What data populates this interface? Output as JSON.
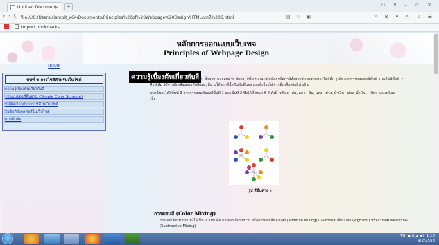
{
  "browser": {
    "tab_title": "Untitled Document",
    "url": "file:///C:/Users/siambit_x64/Documents/Principles%20of%20Webpage%20Design/HTML/บทที่%206.html",
    "bookmarks_label": "Import bookmarks"
  },
  "page": {
    "title_th": "หลักการออกแบบเว็บเพจ",
    "title_en": "Principles of Webpage Design"
  },
  "sidebar": {
    "home_label": "HOME",
    "menu_title": "บทที่ 6 การใช้สีสำหรับเว็บไซต์",
    "items": [
      {
        "label": "ความรู้เบื้องต้นเกี่ยวกับสี"
      },
      {
        "label": "รูปแบบของสีพื้นฐาน (Simple Color Scheme)"
      },
      {
        "label": "ข้อคิดเกี่ยวกับการใช้สีในเว็บไซต์"
      },
      {
        "label": "ปัจจัยที่ส่งผลต่อสีในเว็บไซต์"
      },
      {
        "label": "แบบฝึกหัด"
      }
    ]
  },
  "content": {
    "heading": "ความรู้เบื้องต้นเกี่ยวกับสี",
    "para1": "แม่สีหรือสีขั้นต้น (Primary Color) ทั้งสามประกอบด้วย สีแดง, สีน้ำเงินและสีเหลือง เมื่อนำสีทั้งสามสีมาผสมกันจะได้สีอื่น ๆ อีก จากการผสมแม่สีขั้นที่ 1 จะได้สีขั้นที่ 2 คือ สีส้ม ได้จากสีเหลืองผสมกับสีแดง, สีม่วงได้จากสีน้ำเงินกับสีแดง และสีเขียวได้จากสีเหลืองกับสีน้ำเงิน",
    "para2": "จากนั้นจะได้สีขั้นที่ 3 จากการผสมสีของสีขั้นที่ 1 และขั้นที่ 2 ซึ่งได้ทั้งหมด 6 สี ดังนี้ เหลือง - ส้ม, แดง - ส้ม, แดง - ม่วง, น้ำเงิน - ม่วง, น้ำเงิน - เขียว และเหลือง - เขียว",
    "figure_caption": "รูป สีขั้นต่าง ๆ",
    "subheading": "การผสมสี (Color Mixing)",
    "para3": "การผสมสีสามารถแบ่งได้เป็น 2 แบบ คือ การผสมสีแบบบวก หรือการผสมสีของแสง (Additive Mixing) และการผสมสีแบบลบ (Pigment) หรือการผสมของวรรณะ (Subtractive Mixing)"
  },
  "taskbar": {
    "tray_text": "TH",
    "time": "1:13",
    "date": "9/2/2558"
  }
}
